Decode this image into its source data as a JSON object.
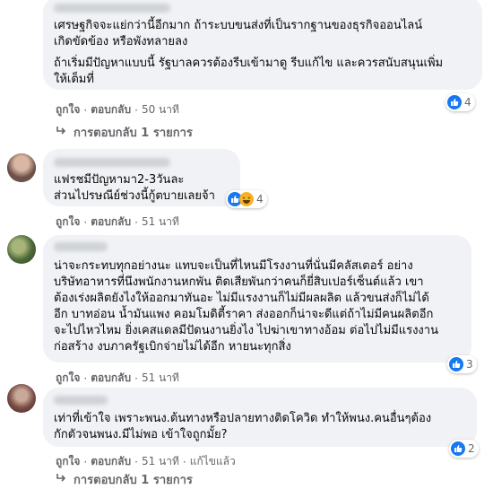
{
  "comments": [
    {
      "lines": [
        "เศรษฐกิจจะแย่กว่านี้อีกมาก ถ้าระบบขนส่งที่เป็นรากฐานของธุรกิจออนไลน์",
        "เกิดขัดข้อง หรือพังทลายลง",
        "",
        "ถ้าเริ่มมีปัญหาแบบนี้ รัฐบาลควรต้องรีบเข้ามาดู รีบแก้ไข และควรสนับสนุนเพิ่ม",
        "ให้เต็มที่"
      ],
      "reaction_count": "4",
      "like_label": "ถูกใจ",
      "reply_label": "ตอบกลับ",
      "time": "50 นาที",
      "replies_label": "การตอบกลับ 1 รายการ"
    },
    {
      "lines": [
        "แฟรชมีปัญหามา2-3วันละ",
        "ส่วนไปรษณีย์ช่วงนี้กู้ตบายเลยจ้า"
      ],
      "reaction_count": "4",
      "like_label": "ถูกใจ",
      "reply_label": "ตอบกลับ",
      "time": "51 นาที"
    },
    {
      "lines": [
        "น่าจะกระทบทุกอย่างนะ แทบจะเป็นที่ไหนมีโรงงานที่นั่นมีคลัสเตอร์ อย่าง",
        "บริษัทอาหารที่นึงพนักงานหกพัน ติดเสียพันกว่าคนก็ยี่สิบเปอร์เซ็นต์แล้ว เขา",
        "ต้องเร่งผลิตยังไงให้ออกมาทันอะ ไม่มีแรงงานก็ไม่มีผลผลิต แล้วขนส่งก็ไม่ได้",
        "อีก บาทอ่อน น้ำมันแพง คอมโมดิตี้ราคา ส่งออกก็น่าจะดีแต่ถ้าไม่มีคนผลิตอีก",
        "จะไปไหวไหม ยิ่งเคสแดลมีปัดนงานยิ่งไง ไปฆ่าเขาทางอ้อม ต่อไปไม่มีแรงงาน",
        "ก่อสร้าง งบภาครัฐเบิกจ่ายไม่ได้อีก หายนะทุกสิ่ง"
      ],
      "reaction_count": "3",
      "like_label": "ถูกใจ",
      "reply_label": "ตอบกลับ",
      "time": "51 นาที"
    },
    {
      "lines": [
        "เท่าที่เข้าใจ เพราะพนง.ต้นทางหรือปลายทางติดโควิด ทำให้พนง.คนอื่นๆต้อง",
        "กักตัวจนพนง.มีไม่พอ เข้าใจถูกมั้ย?"
      ],
      "reaction_count": "2",
      "like_label": "ถูกใจ",
      "reply_label": "ตอบกลับ",
      "time": "51 นาที",
      "edited_label": "แก้ไขแล้ว",
      "replies_label": "การตอบกลับ 1 รายการ"
    }
  ],
  "colors": {
    "bubble": "#f0f2f5",
    "meta_text": "#65676b",
    "like_blue": "#1877f2",
    "haha_yellow": "#f7b125",
    "angry_orange": "#e9710f"
  },
  "icons": {
    "reply_arrow": "reply-arrow-icon",
    "like": "like-icon",
    "haha": "haha-icon",
    "angry": "angry-icon"
  }
}
